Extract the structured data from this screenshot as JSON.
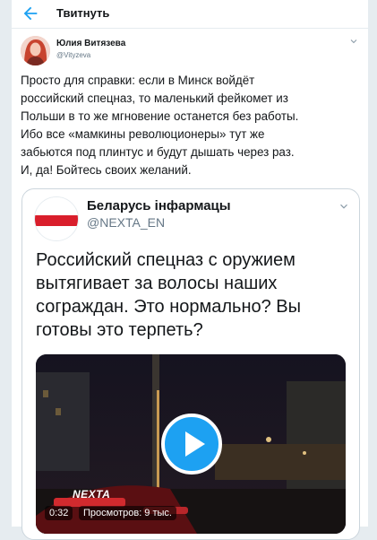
{
  "header": {
    "title": "Твитнуть"
  },
  "tweet": {
    "author_name": "Юлия Витязева",
    "author_handle": "@Vityzeva",
    "text": "Просто для справки: если в Минск войдёт\nроссийский спецназ, то маленький фейкомет из\nПольши в то же мгновение останется без работы.\nИбо все «мамкины революционеры» тут же\nзабьются под плинтус и будут дышать через раз.\nИ, да! Бойтесь своих желаний."
  },
  "quote": {
    "author_name": "Беларусь інфармацы",
    "author_handle": "@NEXTA_EN",
    "text": "Российский спецназ с оружием\nвытягивает за волосы наших\nсограждан. Это нормально? Вы\nготовы это терпеть?",
    "video": {
      "logo": "NEXTA",
      "duration": "0:32",
      "views": "Просмотров: 9 тыс."
    }
  },
  "colors": {
    "accent": "#1da1f2",
    "flag_white": "#ffffff",
    "flag_red": "#d91e2b"
  },
  "icons": {
    "back": "arrow-left-icon",
    "caret": "chevron-down-icon",
    "play": "play-icon"
  }
}
